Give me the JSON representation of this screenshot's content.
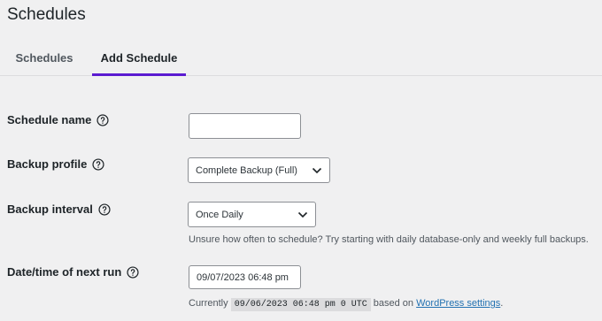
{
  "page": {
    "title": "Schedules"
  },
  "tabs": [
    {
      "label": "Schedules",
      "active": false
    },
    {
      "label": "Add Schedule",
      "active": true
    }
  ],
  "form": {
    "schedule_name": {
      "label": "Schedule name",
      "value": ""
    },
    "backup_profile": {
      "label": "Backup profile",
      "selected": "Complete Backup (Full)"
    },
    "backup_interval": {
      "label": "Backup interval",
      "selected": "Once Daily",
      "hint": "Unsure how often to schedule? Try starting with daily database-only and weekly full backups."
    },
    "next_run": {
      "label": "Date/time of next run",
      "value": "09/07/2023 06:48 pm",
      "hint_prefix": "Currently",
      "current_time": "09/06/2023 06:48 pm 0 UTC",
      "hint_middle": "based on",
      "settings_link": "WordPress settings",
      "hint_suffix": "."
    }
  },
  "colors": {
    "accent_tab": "#5b1bd1",
    "link": "#2271b1",
    "background": "#f0f0f1"
  },
  "icons": {
    "help": "help-circle-icon",
    "dropdown": "chevron-down-icon"
  }
}
